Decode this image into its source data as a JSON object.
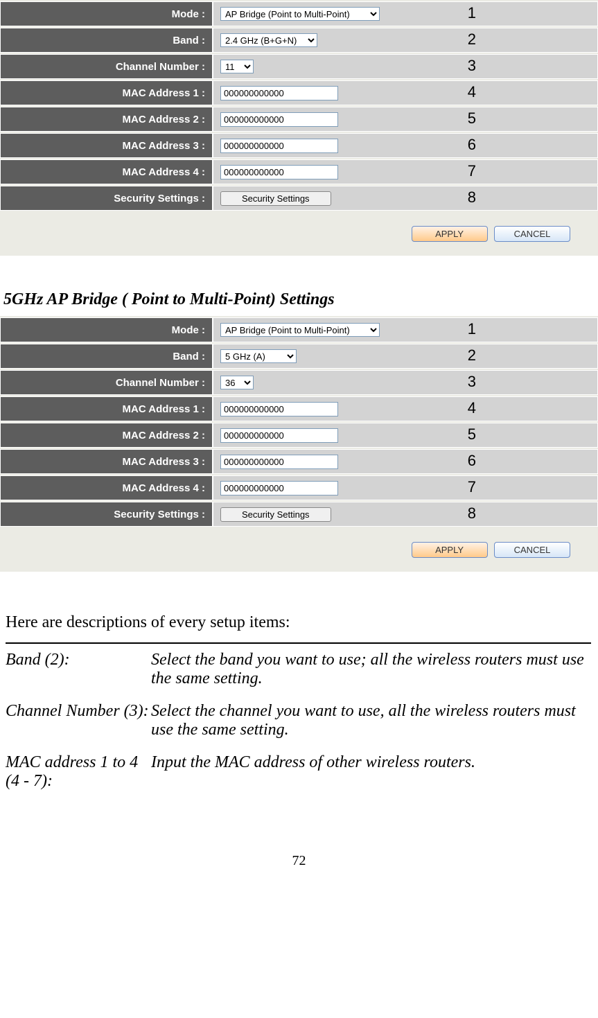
{
  "panel1": {
    "rows": [
      {
        "label": "Mode :",
        "type": "select",
        "value": "AP Bridge (Point to Multi-Point)",
        "num": "1"
      },
      {
        "label": "Band :",
        "type": "select",
        "value": "2.4 GHz (B+G+N)",
        "num": "2"
      },
      {
        "label": "Channel Number :",
        "type": "select",
        "value": "11",
        "num": "3"
      },
      {
        "label": "MAC Address 1 :",
        "type": "input",
        "value": "000000000000",
        "num": "4"
      },
      {
        "label": "MAC Address 2 :",
        "type": "input",
        "value": "000000000000",
        "num": "5"
      },
      {
        "label": "MAC Address 3 :",
        "type": "input",
        "value": "000000000000",
        "num": "6"
      },
      {
        "label": "MAC Address 4 :",
        "type": "input",
        "value": "000000000000",
        "num": "7"
      },
      {
        "label": "Security Settings :",
        "type": "button",
        "value": "Security Settings",
        "num": "8"
      }
    ],
    "apply": "APPLY",
    "cancel": "CANCEL"
  },
  "section_title": "5GHz AP Bridge ( Point to Multi-Point) Settings",
  "panel2": {
    "rows": [
      {
        "label": "Mode :",
        "type": "select",
        "value": "AP Bridge (Point to Multi-Point)",
        "num": "1"
      },
      {
        "label": "Band :",
        "type": "select",
        "value": "5 GHz (A)",
        "num": "2"
      },
      {
        "label": "Channel Number :",
        "type": "select",
        "value": "36",
        "num": "3"
      },
      {
        "label": "MAC Address 1 :",
        "type": "input",
        "value": "000000000000",
        "num": "4"
      },
      {
        "label": "MAC Address 2 :",
        "type": "input",
        "value": "000000000000",
        "num": "5"
      },
      {
        "label": "MAC Address 3 :",
        "type": "input",
        "value": "000000000000",
        "num": "6"
      },
      {
        "label": "MAC Address 4 :",
        "type": "input",
        "value": "000000000000",
        "num": "7"
      },
      {
        "label": "Security Settings :",
        "type": "button",
        "value": "Security Settings",
        "num": "8"
      }
    ],
    "apply": "APPLY",
    "cancel": "CANCEL"
  },
  "desc_intro": "Here are descriptions of every setup items:",
  "descriptions": [
    {
      "label": "Band (2):",
      "text": "Select the band you want to use; all the wireless routers must use the same setting."
    },
    {
      "label": "Channel Number (3):",
      "text": "Select the channel you want to use, all the wireless routers must use the same setting."
    },
    {
      "label": "MAC address 1 to 4 (4 - 7):",
      "text": "Input the MAC address of other wireless routers."
    }
  ],
  "page_num": "72"
}
